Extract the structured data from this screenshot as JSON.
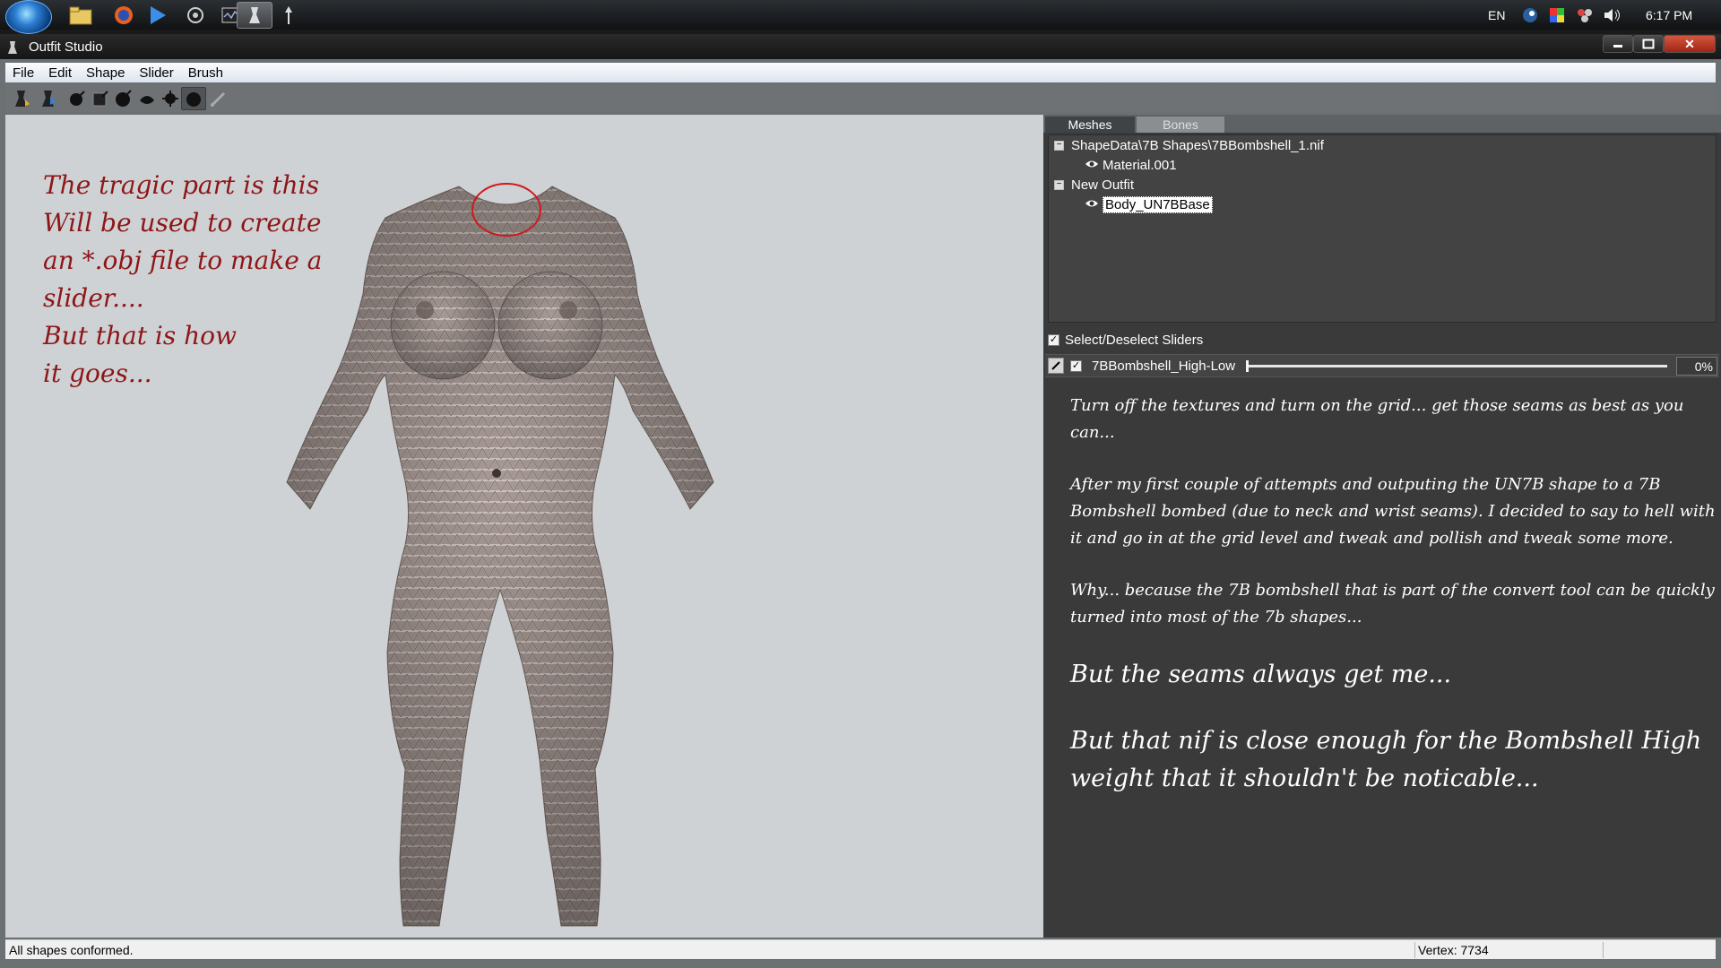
{
  "taskbar": {
    "buttons": [
      "file-explorer-icon",
      "firefox-icon",
      "media-player-icon",
      "app-icon",
      "resource-monitor-icon",
      "outfit-studio-icon",
      "pin-icon"
    ],
    "tray": {
      "language": "EN",
      "clock": "6:17 PM"
    }
  },
  "window": {
    "title": "Outfit Studio",
    "controls": {
      "close": "✕"
    }
  },
  "menu": [
    "File",
    "Edit",
    "Shape",
    "Slider",
    "Brush"
  ],
  "viewport": {
    "note_top": [
      "The tragic part is this",
      "Will be used to create",
      "an *.obj file to make a",
      "slider...."
    ],
    "note_bottom": [
      "But that is how",
      "it goes..."
    ],
    "highlight_color": "#d0181c",
    "annotation_color": "#8e1618"
  },
  "tabs": {
    "meshes": "Meshes",
    "bones": "Bones"
  },
  "tree": {
    "nodes": [
      {
        "label": "ShapeData\\7B Shapes\\7BBombshell_1.nif",
        "expander": "−"
      },
      {
        "label": "Material.001"
      },
      {
        "label": "New Outfit",
        "expander": "−"
      },
      {
        "label": "Body_UN7BBase"
      }
    ]
  },
  "sliders": {
    "select_all_label": "Select/Deselect Sliders",
    "check_mark": "✓",
    "items": [
      {
        "name": "7BBombshell_High-Low",
        "value": "0%",
        "checked": true,
        "value_fraction": 0.0
      }
    ]
  },
  "notes": {
    "p1": "Turn off the textures and turn on the grid... get those seams as best as you can...",
    "p2": "After my first couple of attempts and outputing the UN7B shape to a 7B Bombshell bombed (due to neck and wrist seams). I decided to say to hell with it and go in at the grid level and tweak and pollish and tweak some more.",
    "p3": "Why... because the 7B bombshell that is part of the convert tool can be quickly turned into most of the 7b shapes...",
    "p4": "But the seams always get me...",
    "p5": "But that nif is close enough for the Bombshell High weight that it shouldn't be noticable..."
  },
  "status": {
    "message": "All shapes conformed.",
    "vertex": "Vertex: 7734"
  }
}
